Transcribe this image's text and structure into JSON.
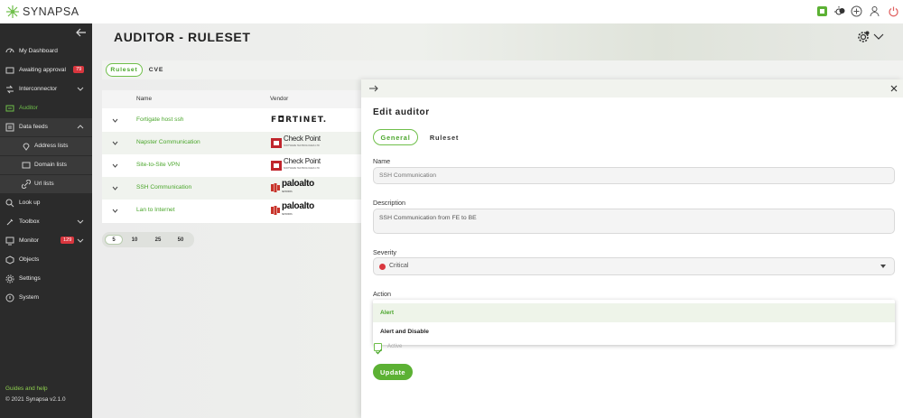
{
  "app": {
    "logo_text": "SYNAPSA"
  },
  "sidebar": {
    "items": [
      {
        "label": "My Dashboard",
        "icon": "dashboard-icon"
      },
      {
        "label": "Awaiting approval",
        "icon": "approval-icon",
        "badge": "79"
      },
      {
        "label": "Interconnector",
        "icon": "interconnector-icon"
      },
      {
        "label": "Auditor",
        "icon": "auditor-icon"
      },
      {
        "label": "Data feeds",
        "icon": "data-feeds-icon"
      },
      {
        "label": "Address lists",
        "icon": "address-lists-icon"
      },
      {
        "label": "Domain lists",
        "icon": "domain-lists-icon"
      },
      {
        "label": "Url lists",
        "icon": "url-lists-icon"
      },
      {
        "label": "Look up",
        "icon": "lookup-icon"
      },
      {
        "label": "Toolbox",
        "icon": "toolbox-icon"
      },
      {
        "label": "Monitor",
        "icon": "monitor-icon",
        "badge": "129"
      },
      {
        "label": "Objects",
        "icon": "objects-icon"
      },
      {
        "label": "Settings",
        "icon": "settings-icon"
      },
      {
        "label": "System",
        "icon": "system-icon"
      }
    ],
    "guides": "Guides and help",
    "copyright": "© 2021 Synapsa v2.1.0"
  },
  "header": {
    "title": "AUDITOR - RULESET"
  },
  "tabs": {
    "ruleset": "Ruleset",
    "cve": "CVE"
  },
  "table": {
    "columns": {
      "name": "Name",
      "vendor": "Vendor"
    },
    "rows": [
      {
        "name": "Fortigate host ssh",
        "vendor": "FORTINET"
      },
      {
        "name": "Napster Communication",
        "vendor": "Check Point"
      },
      {
        "name": "Site-to-Site VPN",
        "vendor": "Check Point"
      },
      {
        "name": "SSH Communication",
        "vendor": "paloalto"
      },
      {
        "name": "Lan to Internet",
        "vendor": "paloalto"
      }
    ],
    "vendor_text": {
      "fortinet": "F◘RTINET.",
      "checkpoint": "Check Point",
      "checkpoint_sub": "SOFTWARE TECHNOLOGIES LTD",
      "paloalto": "paloalto",
      "paloalto_sub": "NETWORKS"
    }
  },
  "pagination": {
    "options": [
      "5",
      "10",
      "25",
      "50"
    ],
    "selected": "5"
  },
  "drawer": {
    "title": "Edit auditor",
    "tabs": {
      "general": "General",
      "ruleset": "Ruleset"
    },
    "name_label": "Name",
    "name_placeholder": "SSH Communication",
    "description_label": "Description",
    "description_value": "SSH Communication from FE to BE",
    "severity_label": "Severity",
    "severity_value": "Critical",
    "severity_color": "#d9363e",
    "action_label": "Action",
    "action_options": [
      "Alert",
      "Alert and Disable"
    ],
    "action_highlighted": "Alert",
    "active_label": "Active",
    "active_checked": true,
    "update_label": "Update"
  },
  "colors": {
    "accent": "#5cb134",
    "sidebar_bg": "#2b2b2b",
    "badge": "#d9363e"
  }
}
